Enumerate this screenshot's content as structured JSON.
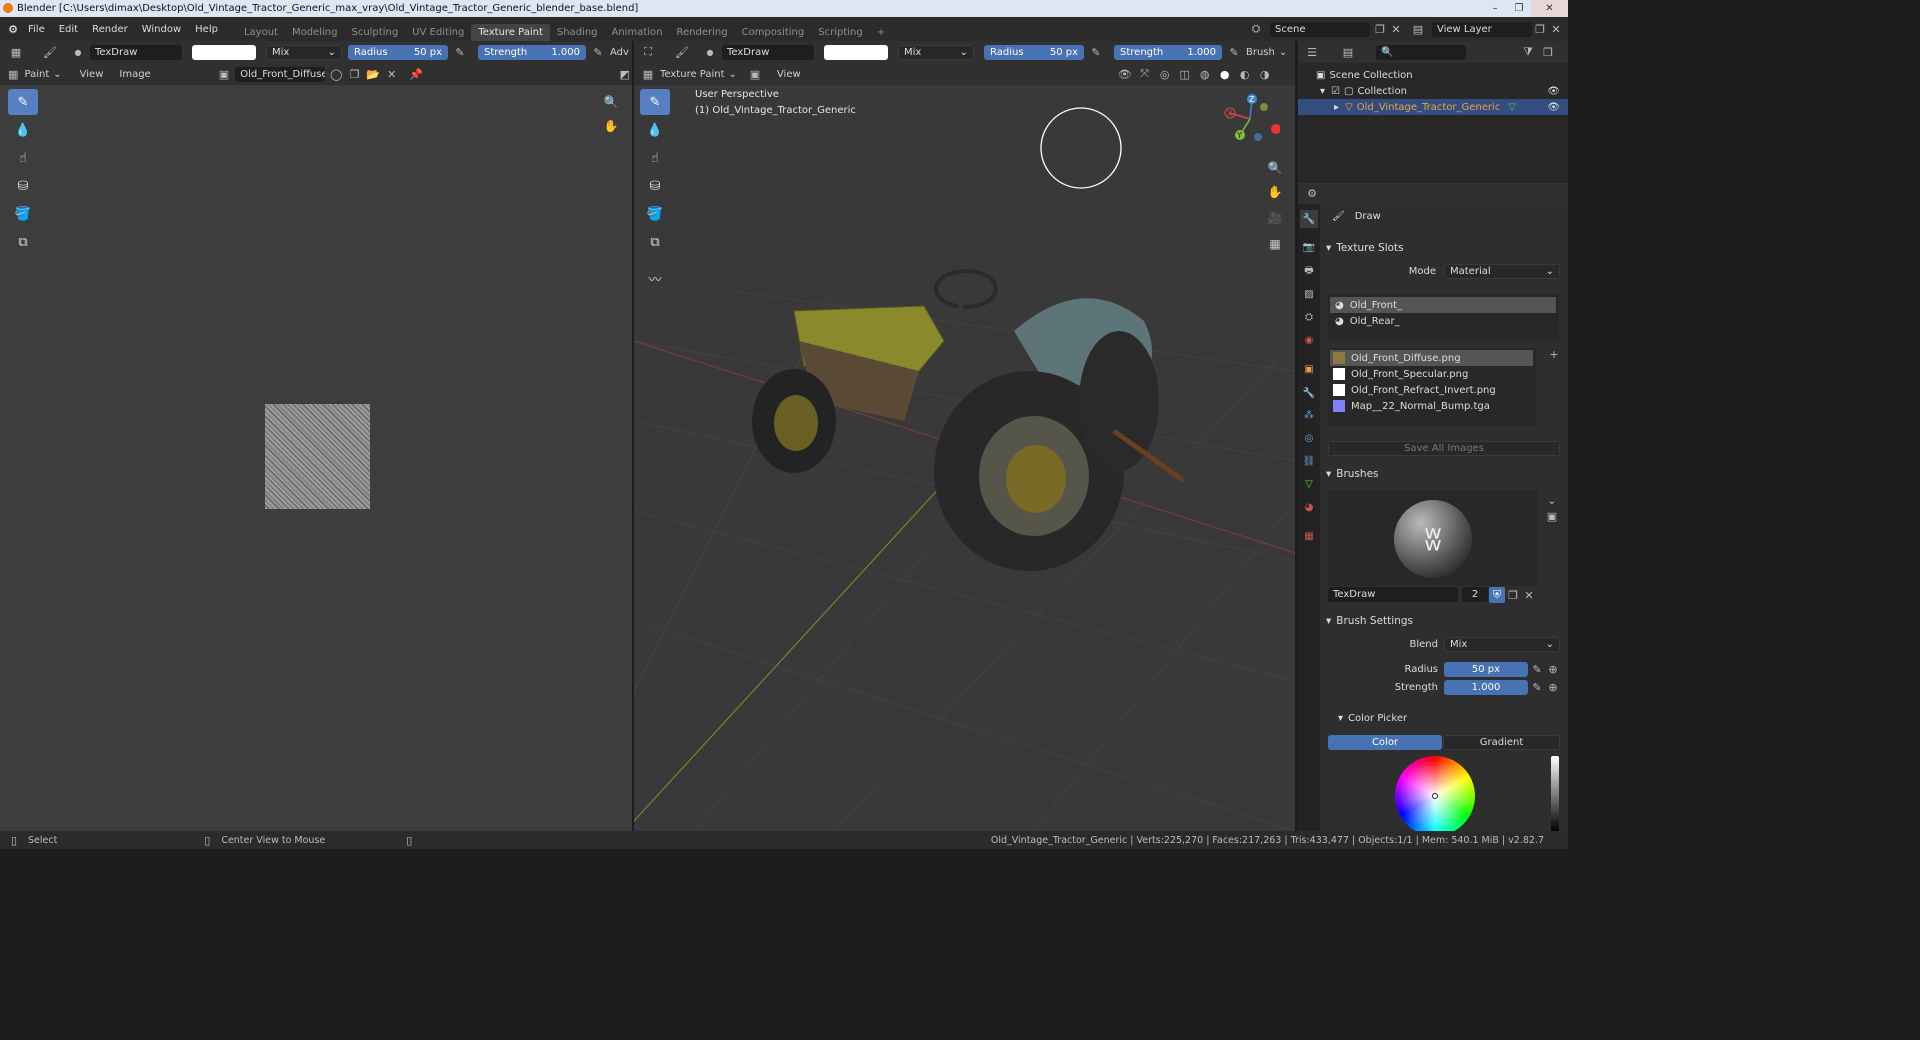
{
  "window": {
    "title": "Blender [C:\\Users\\dimax\\Desktop\\Old_Vintage_Tractor_Generic_max_vray\\Old_Vintage_Tractor_Generic_blender_base.blend]",
    "minimize": "–",
    "maximize": "❐",
    "close": "✕"
  },
  "menu": {
    "items": [
      "File",
      "Edit",
      "Render",
      "Window",
      "Help"
    ]
  },
  "workspaces": {
    "tabs": [
      "Layout",
      "Modeling",
      "Sculpting",
      "UV Editing",
      "Texture Paint",
      "Shading",
      "Animation",
      "Rendering",
      "Compositing",
      "Scripting"
    ],
    "add": "+"
  },
  "scene": {
    "label": "Scene",
    "view_layer": "View Layer"
  },
  "left_header": {
    "brush": "TexDraw",
    "blend": "Mix",
    "radius_label": "Radius",
    "radius_value": "50 px",
    "strength_label": "Strength",
    "strength_value": "1.000",
    "adv": "Adv"
  },
  "left_header2": {
    "mode": "Paint",
    "view": "View",
    "image": "Image",
    "image_name": "Old_Front_Diffuse.png"
  },
  "viewport_header": {
    "brush": "TexDraw",
    "blend": "Mix",
    "radius_label": "Radius",
    "radius_value": "50 px",
    "strength_label": "Strength",
    "strength_value": "1.000",
    "brush_menu": "Brush"
  },
  "viewport_header2": {
    "mode": "Texture Paint",
    "view": "View"
  },
  "viewport": {
    "perspective": "User Perspective",
    "object": "(1) Old_Vintage_Tractor_Generic",
    "gizmo": {
      "x": "X",
      "y": "Y",
      "z": "Z"
    }
  },
  "outliner": {
    "scene_collection": "Scene Collection",
    "collection": "Collection",
    "object": "Old_Vintage_Tractor_Generic"
  },
  "properties": {
    "tool": "Draw",
    "texture_slots": {
      "title": "Texture Slots",
      "mode_label": "Mode",
      "mode_value": "Material",
      "materials": [
        "Old_Front_",
        "Old_Rear_"
      ],
      "images": [
        {
          "name": "Old_Front_Diffuse.png",
          "color": "#8a7a40"
        },
        {
          "name": "Old_Front_Specular.png",
          "color": "#ffffff"
        },
        {
          "name": "Old_Front_Refract_Invert.png",
          "color": "#ffffff"
        },
        {
          "name": "Map__22_Normal_Bump.tga",
          "color": "#8080ff"
        }
      ],
      "save_all": "Save All Images"
    },
    "brushes": {
      "title": "Brushes",
      "name": "TexDraw",
      "users": "2"
    },
    "brush_settings": {
      "title": "Brush Settings",
      "blend_label": "Blend",
      "blend_value": "Mix",
      "radius_label": "Radius",
      "radius_value": "50 px",
      "strength_label": "Strength",
      "strength_value": "1.000"
    },
    "color_picker": {
      "title": "Color Picker",
      "color_tab": "Color",
      "gradient_tab": "Gradient"
    }
  },
  "status": {
    "select": "Select",
    "center": "Center View to Mouse",
    "stats": "Old_Vintage_Tractor_Generic | Verts:225,270 | Faces:217,263 | Tris:433,477 | Objects:1/1 | Mem: 540.1 MiB | v2.82.7"
  },
  "colors": {
    "accent": "#4772b3",
    "active_tool": "#5680c2",
    "selected_row": "#334d80",
    "object_orange": "#e8a33a"
  }
}
